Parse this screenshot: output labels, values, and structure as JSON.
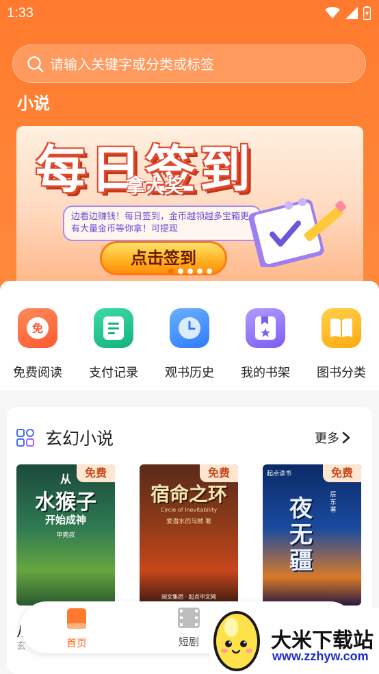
{
  "status": {
    "time": "1:33"
  },
  "search": {
    "placeholder": "请输入关键字或分类或标签"
  },
  "section_title": "小说",
  "banner": {
    "title": "每日签到",
    "subtitle": "拿大奖",
    "desc": "边看边赚钱！每日签到，金币越领越多宝箱更有大量金币等你拿！可提现",
    "button_label": "点击签到",
    "dots": 5,
    "active_dot": 0
  },
  "nav": [
    {
      "label": "免费阅读",
      "icon": "free-read-icon",
      "color": "#ff6a3a",
      "glyph": "免"
    },
    {
      "label": "支付记录",
      "icon": "payment-record-icon",
      "color": "#22c28c"
    },
    {
      "label": "观书历史",
      "icon": "clock-history-icon",
      "color": "#3a8cff"
    },
    {
      "label": "我的书架",
      "icon": "bookshelf-icon",
      "color": "#8a6cf0"
    },
    {
      "label": "图书分类",
      "icon": "book-category-icon",
      "color": "#ffb020"
    }
  ],
  "book_section": {
    "title": "玄幻小说",
    "more_label": "更多",
    "books": [
      {
        "badge": "免费",
        "cover_title": "水猴子",
        "cover_pre": "从",
        "cover_sub": "开始成神",
        "cover_publisher": "甲壳叔"
      },
      {
        "badge": "免费",
        "cover_title": "宿命之环",
        "cover_sub": "Circle of Inevitability",
        "cover_author": "爱潜水的乌贼 著",
        "cover_publisher": "阅文集团 · 起点中文网"
      },
      {
        "badge": "免费",
        "cover_title": "夜无疆",
        "cover_author": "辰东 著",
        "cover_publisher": "起点读书"
      }
    ],
    "peek_title": "从",
    "peek_sub": "玄"
  },
  "bottom_nav": {
    "tabs": [
      {
        "label": "首页",
        "icon": "home-book-icon",
        "active": true
      },
      {
        "label": "短剧",
        "icon": "film-icon",
        "active": false
      }
    ]
  },
  "watermark": {
    "title": "大米下载站",
    "url": "www.zzhyw.com"
  }
}
